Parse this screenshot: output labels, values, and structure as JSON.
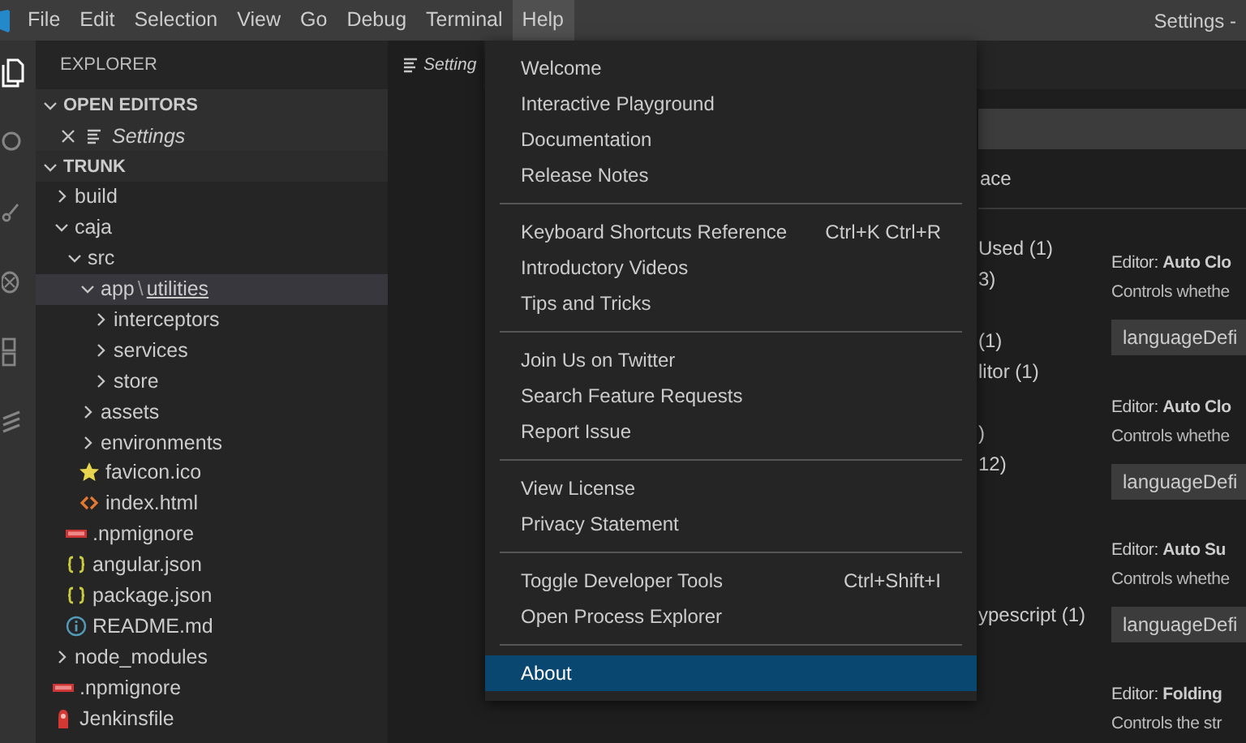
{
  "window": {
    "title": "Settings -"
  },
  "menubar": [
    {
      "label": "File",
      "selected": false
    },
    {
      "label": "Edit",
      "selected": false
    },
    {
      "label": "Selection",
      "selected": false
    },
    {
      "label": "View",
      "selected": false
    },
    {
      "label": "Go",
      "selected": false
    },
    {
      "label": "Debug",
      "selected": false
    },
    {
      "label": "Terminal",
      "selected": false
    },
    {
      "label": "Help",
      "selected": true
    }
  ],
  "help_menu": {
    "groups": [
      [
        {
          "label": "Welcome",
          "selected": false
        },
        {
          "label": "Interactive Playground",
          "selected": false
        },
        {
          "label": "Documentation",
          "selected": false
        },
        {
          "label": "Release Notes",
          "selected": false
        }
      ],
      [
        {
          "label": "Keyboard Shortcuts Reference",
          "shortcut": "Ctrl+K Ctrl+R",
          "selected": false
        },
        {
          "label": "Introductory Videos",
          "selected": false
        },
        {
          "label": "Tips and Tricks",
          "selected": false
        }
      ],
      [
        {
          "label": "Join Us on Twitter",
          "selected": false
        },
        {
          "label": "Search Feature Requests",
          "selected": false
        },
        {
          "label": "Report Issue",
          "selected": false
        }
      ],
      [
        {
          "label": "View License",
          "selected": false
        },
        {
          "label": "Privacy Statement",
          "selected": false
        }
      ],
      [
        {
          "label": "Toggle Developer Tools",
          "shortcut": "Ctrl+Shift+I",
          "selected": false
        },
        {
          "label": "Open Process Explorer",
          "selected": false
        }
      ],
      [
        {
          "label": "About",
          "selected": true
        }
      ]
    ]
  },
  "explorer": {
    "title": "EXPLORER",
    "sections": [
      {
        "title": "OPEN EDITORS",
        "expanded": true,
        "editors": [
          {
            "label": "Settings"
          }
        ]
      },
      {
        "title": "TRUNK",
        "expanded": true,
        "tree": [
          {
            "kind": "folder",
            "label": "build",
            "expanded": false,
            "selected": false
          },
          {
            "kind": "folder",
            "label": "caja",
            "expanded": true,
            "selected": false,
            "children": [
              {
                "kind": "folder",
                "label": "src",
                "expanded": true,
                "selected": false,
                "children": [
                  {
                    "kind": "folder",
                    "label": "app",
                    "separator": "\\",
                    "compact_child": "utilities",
                    "expanded": true,
                    "selected": true,
                    "children": [
                      {
                        "kind": "folder",
                        "label": "interceptors",
                        "expanded": false,
                        "selected": false
                      },
                      {
                        "kind": "folder",
                        "label": "services",
                        "expanded": false,
                        "selected": false
                      },
                      {
                        "kind": "folder",
                        "label": "store",
                        "expanded": false,
                        "selected": false
                      }
                    ]
                  },
                  {
                    "kind": "folder",
                    "label": "assets",
                    "expanded": false,
                    "selected": false
                  },
                  {
                    "kind": "folder",
                    "label": "environments",
                    "expanded": false,
                    "selected": false
                  },
                  {
                    "kind": "favicon",
                    "label": "favicon.ico",
                    "selected": false
                  },
                  {
                    "kind": "html",
                    "label": "index.html",
                    "selected": false
                  }
                ]
              },
              {
                "kind": "npm",
                "label": ".npmignore",
                "selected": false
              },
              {
                "kind": "json",
                "label": "angular.json",
                "selected": false
              },
              {
                "kind": "json",
                "label": "package.json",
                "selected": false
              },
              {
                "kind": "info",
                "label": "README.md",
                "selected": false
              }
            ]
          },
          {
            "kind": "folder",
            "label": "node_modules",
            "expanded": false,
            "selected": false
          },
          {
            "kind": "npm",
            "label": ".npmignore",
            "selected": false
          },
          {
            "kind": "jenkins",
            "label": "Jenkinsfile",
            "selected": false
          }
        ]
      }
    ]
  },
  "editor": {
    "tab": {
      "label": "Setting"
    },
    "settings": {
      "scope_tab": "ace",
      "toc_groups": [
        [
          "Used (1)",
          "3)"
        ],
        [
          "(1)",
          "litor (1)"
        ],
        [
          ")",
          "12)"
        ],
        [
          "ypescript (1)"
        ]
      ],
      "entries": [
        {
          "title": "Editor: **Auto Clo**",
          "description": "Controls whethe",
          "value": "languageDefi"
        },
        {
          "title": "Editor: **Auto Clo**",
          "description": "Controls whethe",
          "value": "languageDefi"
        },
        {
          "title": "Editor: **Auto Su**",
          "description": "Controls whethe",
          "value": "languageDefi"
        },
        {
          "title": "Editor: **Folding**",
          "description": "Controls the str"
        }
      ]
    }
  }
}
